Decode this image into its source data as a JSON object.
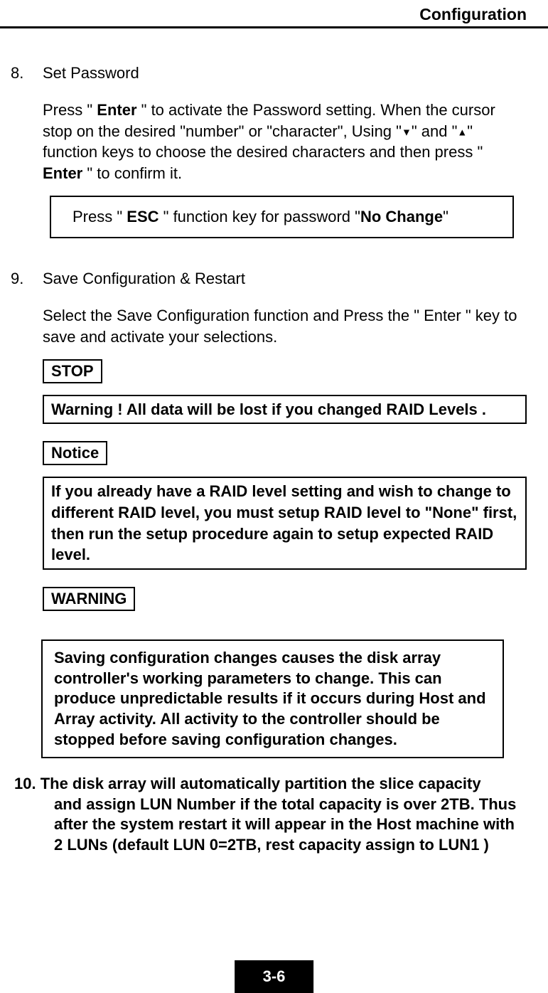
{
  "header": {
    "title": "Configuration"
  },
  "items": {
    "eight": {
      "num": "8.",
      "title": "Set Password",
      "para_part1": "Press \" ",
      "para_enter1": "Enter",
      "para_part2": " \" to activate the Password setting. When the cursor stop on the desired \"number\" or \"character\", Using \"",
      "tri_down": "▼",
      "para_part3": "\" and \"",
      "tri_up": "▲",
      "para_part4": "\" function keys to choose the desired characters and then press \" ",
      "para_enter2": "Enter",
      "para_part5": " \" to confirm it.",
      "box_p1": "Press \" ",
      "box_esc": "ESC",
      "box_p2": " \" function key for password \"",
      "box_nochange": "No Change",
      "box_p3": "\""
    },
    "nine": {
      "num": "9.",
      "title": "Save Configuration & Restart",
      "para": "Select the Save Configuration function and Press the \" Enter \" key to save and activate your selections.",
      "stop_label": "STOP",
      "stop_warning": "Warning ! All data will be lost if you changed RAID Levels .",
      "notice_label": "Notice",
      "notice_text": "If you already have a RAID level setting and wish to change to different RAID level, you must setup RAID level to \"None\" first, then run the setup procedure again to setup expected RAID level.",
      "warning_label": "WARNING",
      "warning_text": "Saving configuration changes causes the disk array controller's working parameters to change. This can produce unpredictable results if it occurs during Host and Array activity. All activity to the controller should be stopped before saving configuration changes."
    },
    "ten": {
      "line1": "10. The disk array will automatically partition the slice capacity",
      "line2": "and assign LUN Number if the total capacity is over 2TB. Thus after the system restart it will appear in the Host machine with 2 LUNs (default LUN 0=2TB, rest capacity assign to LUN1 )"
    }
  },
  "footer": {
    "page": "3-6"
  }
}
